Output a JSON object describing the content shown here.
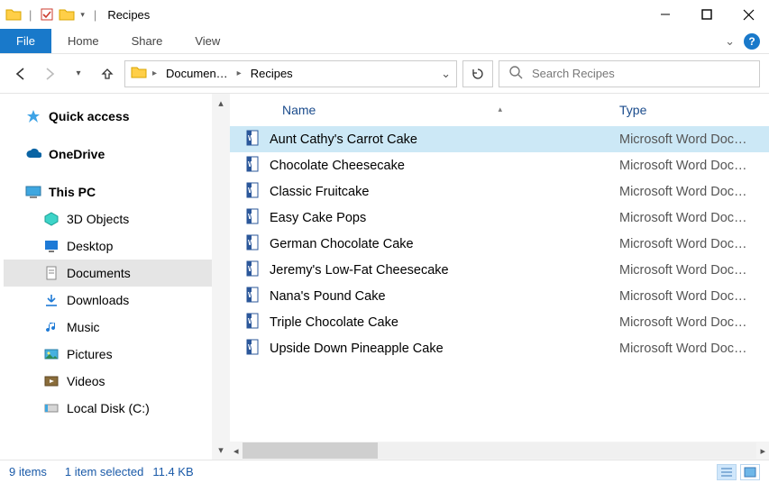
{
  "window": {
    "title": "Recipes"
  },
  "ribbon": {
    "file": "File",
    "tabs": [
      "Home",
      "Share",
      "View"
    ]
  },
  "breadcrumb": {
    "items": [
      "Documen…",
      "Recipes"
    ]
  },
  "search": {
    "placeholder": "Search Recipes"
  },
  "sidebar": {
    "quick_access": "Quick access",
    "onedrive": "OneDrive",
    "this_pc": "This PC",
    "children": [
      {
        "label": "3D Objects",
        "icon": "cube"
      },
      {
        "label": "Desktop",
        "icon": "desktop"
      },
      {
        "label": "Documents",
        "icon": "documents",
        "selected": true
      },
      {
        "label": "Downloads",
        "icon": "downloads"
      },
      {
        "label": "Music",
        "icon": "music"
      },
      {
        "label": "Pictures",
        "icon": "pictures"
      },
      {
        "label": "Videos",
        "icon": "videos"
      },
      {
        "label": "Local Disk (C:)",
        "icon": "disk"
      }
    ]
  },
  "columns": {
    "name": "Name",
    "type": "Type"
  },
  "files": [
    {
      "name": "Aunt Cathy's Carrot Cake",
      "type": "Microsoft Word Doc…",
      "selected": true
    },
    {
      "name": "Chocolate Cheesecake",
      "type": "Microsoft Word Doc…"
    },
    {
      "name": "Classic Fruitcake",
      "type": "Microsoft Word Doc…"
    },
    {
      "name": "Easy Cake Pops",
      "type": "Microsoft Word Doc…"
    },
    {
      "name": "German Chocolate Cake",
      "type": "Microsoft Word Doc…"
    },
    {
      "name": "Jeremy's Low-Fat Cheesecake",
      "type": "Microsoft Word Doc…"
    },
    {
      "name": "Nana's Pound Cake",
      "type": "Microsoft Word Doc…"
    },
    {
      "name": "Triple Chocolate Cake",
      "type": "Microsoft Word Doc…"
    },
    {
      "name": "Upside Down Pineapple Cake",
      "type": "Microsoft Word Doc…"
    }
  ],
  "status": {
    "count": "9 items",
    "selection": "1 item selected",
    "size": "11.4 KB"
  }
}
